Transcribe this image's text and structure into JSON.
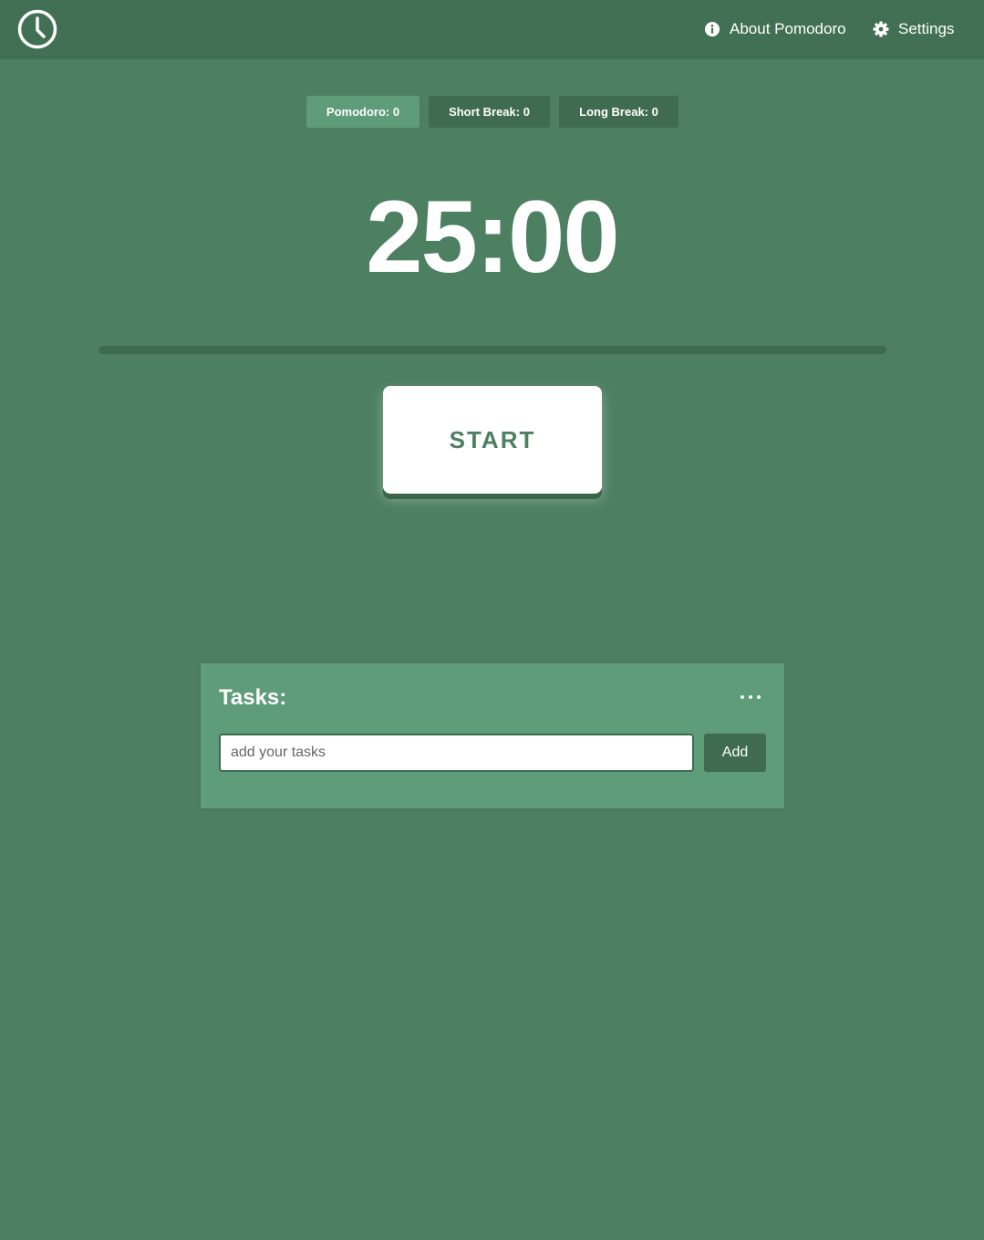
{
  "header": {
    "logo_icon": "clock-icon",
    "nav": {
      "about": {
        "label": "About Pomodoro",
        "icon": "info-icon"
      },
      "settings": {
        "label": "Settings",
        "icon": "gear-icon"
      }
    }
  },
  "modes": {
    "pomodoro": "Pomodoro: 0",
    "short_break": "Short Break: 0",
    "long_break": "Long Break: 0",
    "active": "pomodoro"
  },
  "timer": {
    "display": "25:00",
    "progress": 0
  },
  "start_button": {
    "label": "START"
  },
  "tasks": {
    "title": "Tasks:",
    "menu_icon": "more-horizontal-icon",
    "input_placeholder": "add your tasks",
    "input_value": "",
    "add_label": "Add"
  },
  "colors": {
    "background": "#4d7f61",
    "header": "#427054",
    "active_tab": "#5f9c79",
    "inactive_tab": "#3f6c50",
    "panel": "#5f9c79",
    "text": "#ffffff"
  }
}
